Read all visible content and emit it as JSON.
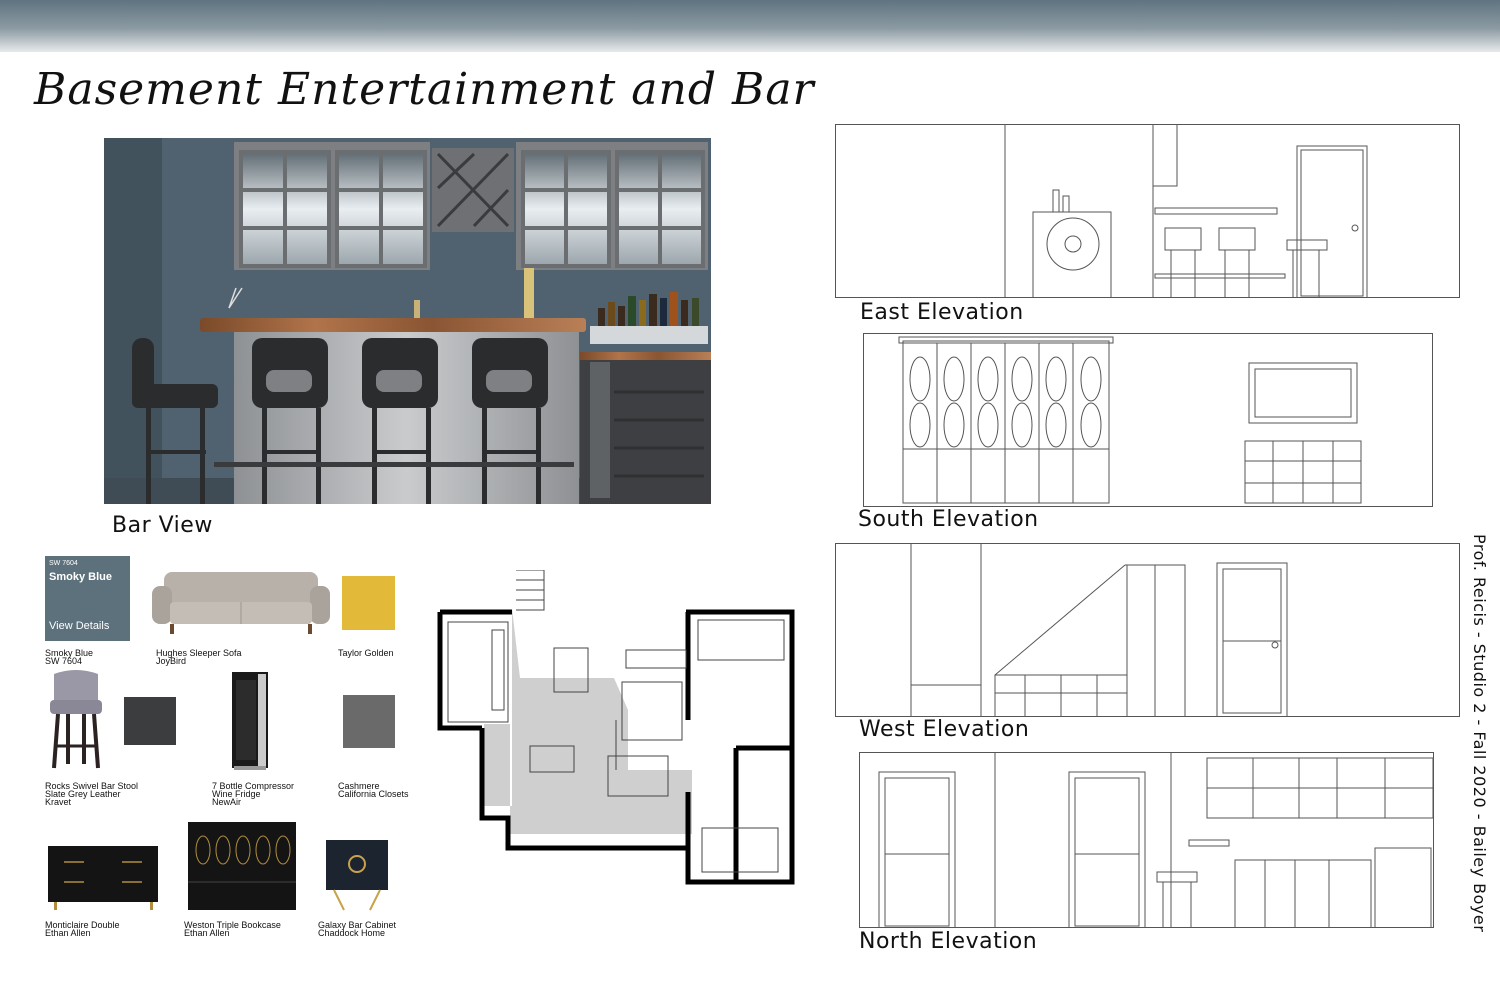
{
  "title": "Basement Entertainment and Bar",
  "bar_view_caption": "Bar View",
  "elevations": {
    "east": "East Elevation",
    "south": "South Elevation",
    "west": "West Elevation",
    "north": "North Elevation"
  },
  "credit": "Prof. Reicis - Studio 2 - Fall 2020 - Bailey Boyer",
  "swatch": {
    "code": "SW 7604",
    "name": "Smoky Blue",
    "link": "View Details",
    "color": "#5d717c"
  },
  "materials": [
    {
      "line1": "Smoky Blue",
      "line2": "SW 7604",
      "line3": ""
    },
    {
      "line1": "Hughes Sleeper Sofa",
      "line2": "JoyBird",
      "line3": ""
    },
    {
      "line1": "Taylor Golden",
      "line2": "",
      "line3": ""
    },
    {
      "line1": "Rocks Swivel Bar Stool",
      "line2": "Slate Grey Leather",
      "line3": "Kravet"
    },
    {
      "line1": "7 Bottle Compressor",
      "line2": "Wine Fridge",
      "line3": "NewAir"
    },
    {
      "line1": "Cashmere",
      "line2": "California Closets",
      "line3": ""
    },
    {
      "line1": "Monticlaire Double",
      "line2": "Ethan Allen",
      "line3": ""
    },
    {
      "line1": "Weston Triple Bookcase",
      "line2": "Ethan Allen",
      "line3": ""
    },
    {
      "line1": "Galaxy Bar Cabinet",
      "line2": "Chaddock Home",
      "line3": ""
    }
  ],
  "colors": {
    "wall": "#4f606c",
    "gold_fabric": "#e3b93a",
    "slate_fabric": "#3c3d3f",
    "cashmere": "#6a6a6a"
  }
}
